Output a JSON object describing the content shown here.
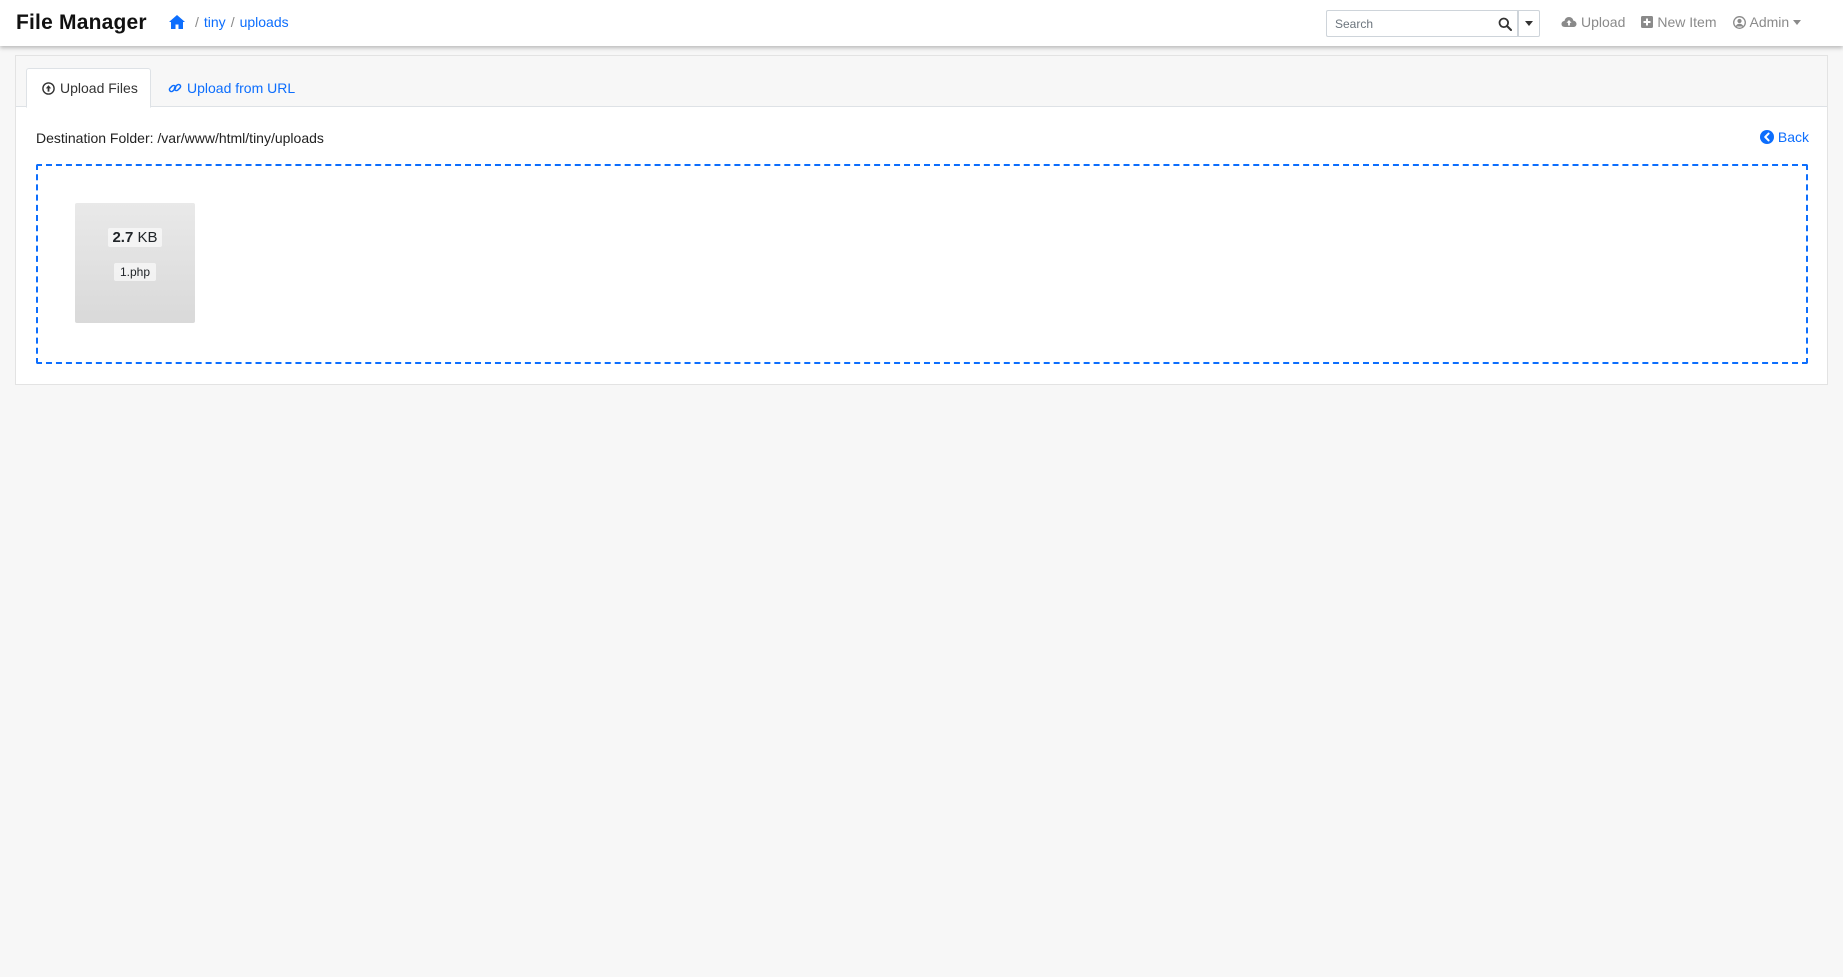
{
  "navbar": {
    "brand": "File Manager",
    "breadcrumb": {
      "home_icon": "home-icon",
      "separator": "/",
      "items": [
        "tiny",
        "uploads"
      ]
    },
    "search": {
      "placeholder": "Search",
      "icon": "search-icon"
    },
    "links": {
      "upload": "Upload",
      "new_item": "New Item",
      "admin": "Admin"
    }
  },
  "tabs": {
    "upload_files": "Upload Files",
    "upload_url": "Upload from URL"
  },
  "destination": "Destination Folder: /var/www/html/tiny/uploads",
  "back_label": "Back",
  "file": {
    "size_value": "2.7",
    "size_unit": "KB",
    "name": "1.php"
  },
  "colors": {
    "accent": "#0d6efd",
    "background": "#f7f7f7",
    "muted": "#8a8a8a"
  }
}
